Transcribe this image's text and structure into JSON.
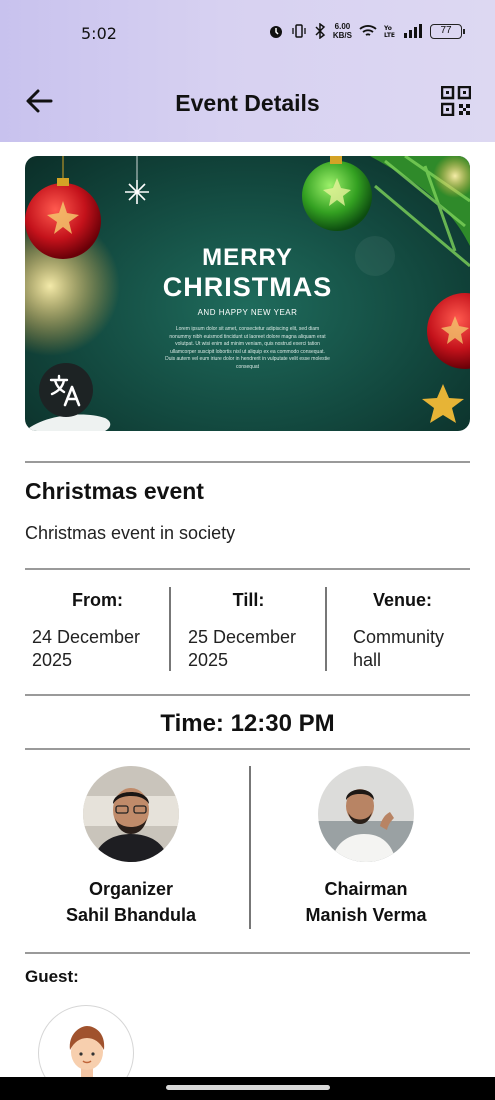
{
  "status_bar": {
    "time": "5:02",
    "net_speed_value": "6.00",
    "net_speed_unit": "KB/S",
    "battery": "77"
  },
  "app_bar": {
    "title": "Event Details",
    "back_icon": "arrow-left-icon",
    "qr_icon": "qr-code-icon"
  },
  "banner": {
    "line1": "MERRY",
    "line2": "CHRISTMAS",
    "line3": "AND HAPPY NEW YEAR",
    "body": "Lorem ipsum dolor sit amet, consectetur adipiscing elit, sed diam nonummy nibh euismod tincidunt ut laoreet dolore magna aliquam erat volutpat. Ut wisi enim ad minim veniam, quis nostrud exerci tation ullamcorper suscipit lobortis nisl ut aliquip ex ea commodo consequat. Duis autem vel eum iriure dolor in hendrerit in vulputate velit esse molestie consequat",
    "translate_icon": "translate-icon"
  },
  "event": {
    "title": "Christmas event",
    "description": "Christmas event in society"
  },
  "details": {
    "from_label": "From:",
    "from_value": "24 December 2025",
    "till_label": "Till:",
    "till_value": "25 December 2025",
    "venue_label": "Venue:",
    "venue_value": "Community hall"
  },
  "time": {
    "text": "Time: 12:30 PM"
  },
  "people": [
    {
      "role": "Organizer",
      "name": "Sahil Bhandula"
    },
    {
      "role": "Chairman",
      "name": "Manish Verma"
    }
  ],
  "guest": {
    "label": "Guest:"
  },
  "colors": {
    "header_bg": "#d4cef0",
    "divider": "#9a9a9a",
    "banner_bg": "#134a40"
  }
}
